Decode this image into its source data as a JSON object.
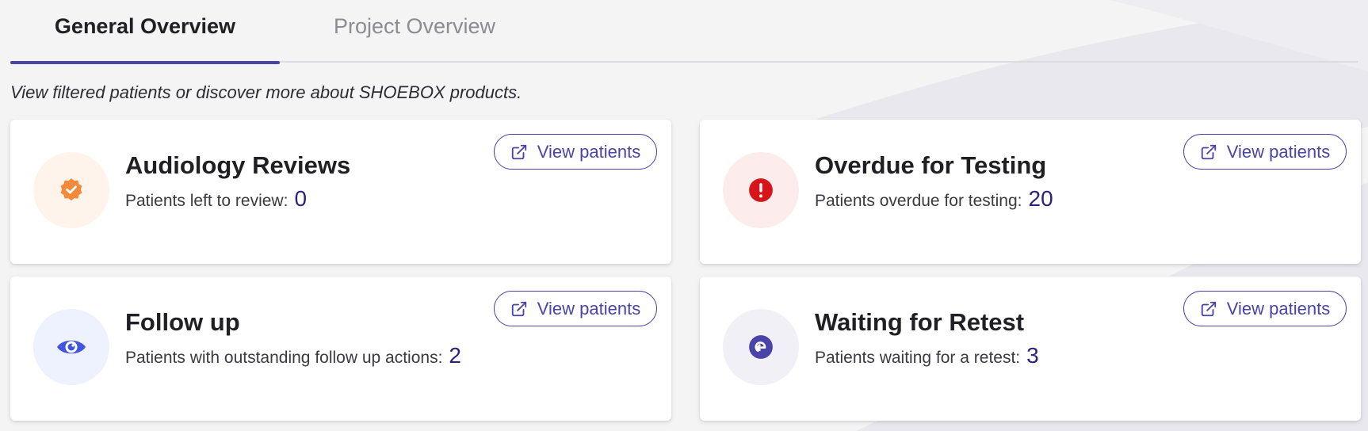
{
  "tabs": [
    {
      "label": "General Overview",
      "active": true
    },
    {
      "label": "Project Overview",
      "active": false
    }
  ],
  "subtitle": "View filtered patients or discover more about SHOEBOX products.",
  "cards": [
    {
      "title": "Audiology Reviews",
      "description": "Patients left to review:",
      "count": "0",
      "button_label": "View patients",
      "icon": "verified-badge-icon",
      "icon_color": "#f4893a",
      "icon_bg": "#fff4ec"
    },
    {
      "title": "Overdue for Testing",
      "description": "Patients overdue for testing:",
      "count": "20",
      "button_label": "View patients",
      "icon": "alert-circle-icon",
      "icon_color": "#d8141b",
      "icon_bg": "#fdecec"
    },
    {
      "title": "Follow up",
      "description": "Patients with outstanding follow up actions:",
      "count": "2",
      "button_label": "View patients",
      "icon": "eye-icon",
      "icon_color": "#3f55e0",
      "icon_bg": "#eef1fe"
    },
    {
      "title": "Waiting for Retest",
      "description": "Patients waiting for a retest:",
      "count": "3",
      "button_label": "View patients",
      "icon": "retest-arrow-icon",
      "icon_color": "#4a43a8",
      "icon_bg": "#f0f0f6"
    }
  ],
  "colors": {
    "accent": "#4a43a8",
    "count": "#2a237d"
  }
}
